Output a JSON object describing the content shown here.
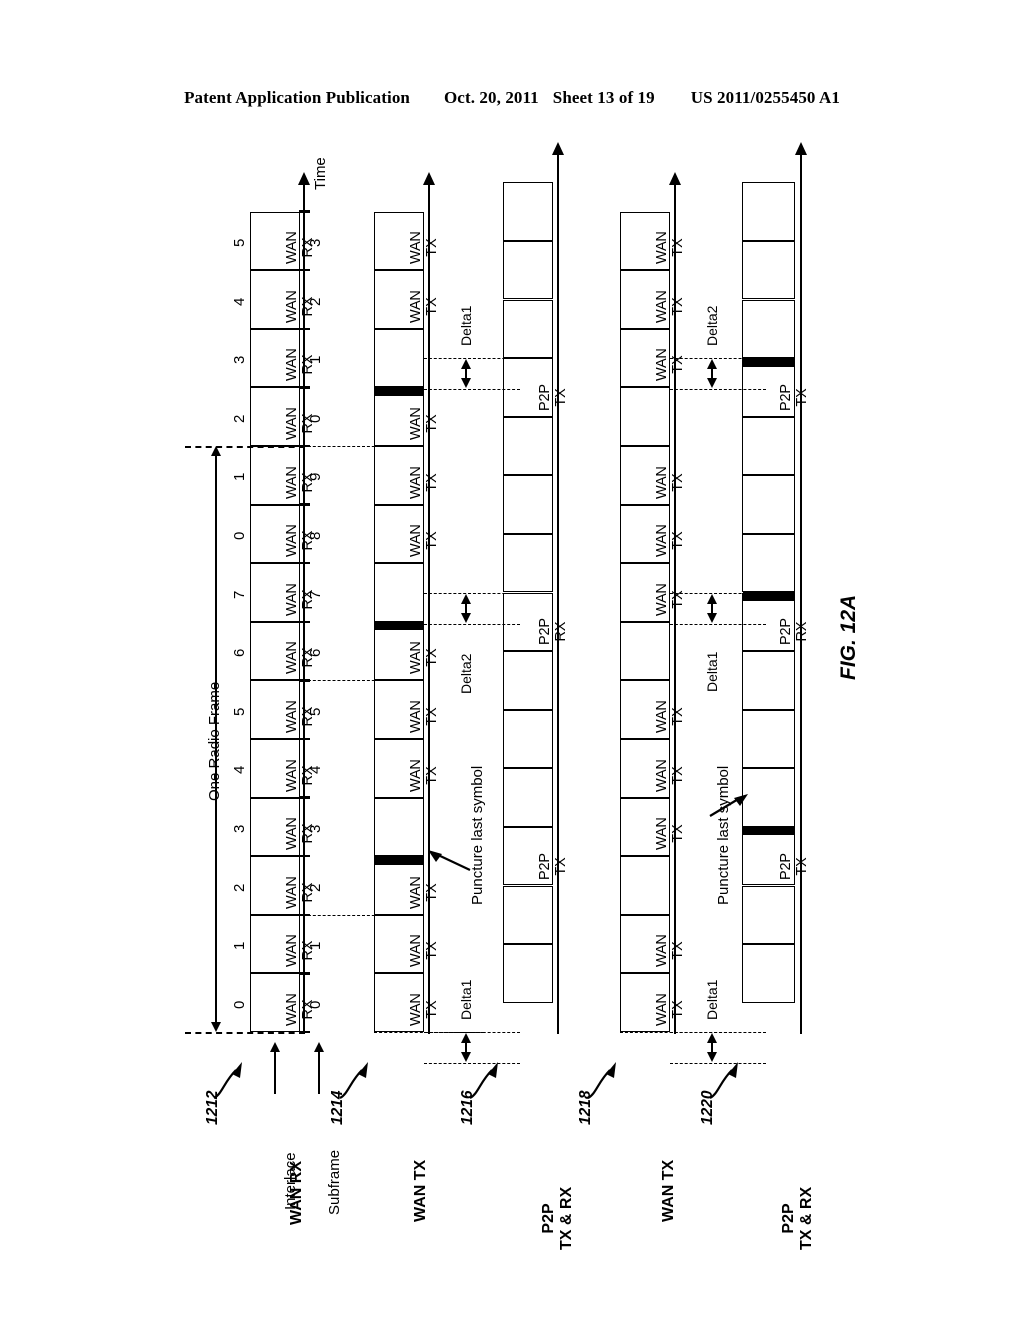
{
  "page_header": {
    "publication": "Patent Application Publication",
    "date": "Oct. 20, 2011",
    "sheet": "Sheet 13 of 19",
    "doc_number": "US 2011/0255450 A1"
  },
  "figure": {
    "label": "FIG. 12A",
    "time_axis_label": "Time",
    "frame_label": "One Radio Frame",
    "row_axis_labels": {
      "interlace": "Interlace",
      "subframe": "Subframe"
    },
    "annotations": {
      "puncture": "Puncture last symbol",
      "delta1": "Delta1",
      "delta2": "Delta2"
    },
    "tracks": [
      {
        "ref": "1212",
        "name": "WAN RX",
        "title_lines": [
          "WAN RX"
        ],
        "interlace_indexes": [
          "0",
          "1",
          "2",
          "3",
          "4",
          "5",
          "6",
          "7",
          "0",
          "1",
          "2",
          "3",
          "4",
          "5"
        ],
        "subframe_indexes": [
          "0",
          "1",
          "2",
          "3",
          "4",
          "5",
          "6",
          "7",
          "8",
          "9",
          "0",
          "1",
          "2",
          "3"
        ],
        "cells": [
          {
            "label": "WAN\nRX",
            "punctured": false
          },
          {
            "label": "WAN\nRX",
            "punctured": false
          },
          {
            "label": "WAN\nRX",
            "punctured": false
          },
          {
            "label": "WAN\nRX",
            "punctured": false
          },
          {
            "label": "WAN\nRX",
            "punctured": false
          },
          {
            "label": "WAN\nRX",
            "punctured": false
          },
          {
            "label": "WAN\nRX",
            "punctured": false
          },
          {
            "label": "WAN\nRX",
            "punctured": false
          },
          {
            "label": "WAN\nRX",
            "punctured": false
          },
          {
            "label": "WAN\nRX",
            "punctured": false
          },
          {
            "label": "WAN\nRX",
            "punctured": false
          },
          {
            "label": "WAN\nRX",
            "punctured": false
          },
          {
            "label": "WAN\nRX",
            "punctured": false
          },
          {
            "label": "WAN\nRX",
            "punctured": false
          }
        ]
      },
      {
        "ref": "1214",
        "name": "WAN TX",
        "title_lines": [
          "WAN TX"
        ],
        "cells": [
          {
            "label": "WAN\nTX",
            "punctured": false
          },
          {
            "label": "WAN\nTX",
            "punctured": false
          },
          {
            "label": "WAN\nTX",
            "punctured": true
          },
          {
            "label": "",
            "punctured": false
          },
          {
            "label": "WAN\nTX",
            "punctured": false
          },
          {
            "label": "WAN\nTX",
            "punctured": false
          },
          {
            "label": "WAN\nTX",
            "punctured": true
          },
          {
            "label": "",
            "punctured": false
          },
          {
            "label": "WAN\nTX",
            "punctured": false
          },
          {
            "label": "WAN\nTX",
            "punctured": false
          },
          {
            "label": "WAN\nTX",
            "punctured": true
          },
          {
            "label": "",
            "punctured": false
          },
          {
            "label": "WAN\nTX",
            "punctured": false
          },
          {
            "label": "WAN\nTX",
            "punctured": false
          }
        ]
      },
      {
        "ref": "1216",
        "name": "P2P TX & RX",
        "title_lines": [
          "P2P",
          "TX & RX"
        ],
        "cells": [
          {
            "label": "",
            "punctured": false
          },
          {
            "label": "",
            "punctured": false
          },
          {
            "label": "P2P\nTX",
            "punctured": false
          },
          {
            "label": "",
            "punctured": false
          },
          {
            "label": "",
            "punctured": false
          },
          {
            "label": "",
            "punctured": false
          },
          {
            "label": "P2P\nRX",
            "punctured": false
          },
          {
            "label": "",
            "punctured": false
          },
          {
            "label": "",
            "punctured": false
          },
          {
            "label": "",
            "punctured": false
          },
          {
            "label": "P2P\nTX",
            "punctured": false
          },
          {
            "label": "",
            "punctured": false
          },
          {
            "label": "",
            "punctured": false
          },
          {
            "label": "",
            "punctured": false
          }
        ]
      },
      {
        "ref": "1218",
        "name": "WAN TX",
        "title_lines": [
          "WAN TX"
        ],
        "cells": [
          {
            "label": "WAN\nTX",
            "punctured": false
          },
          {
            "label": "WAN\nTX",
            "punctured": false
          },
          {
            "label": "",
            "punctured": false
          },
          {
            "label": "WAN\nTX",
            "punctured": false
          },
          {
            "label": "WAN\nTX",
            "punctured": false
          },
          {
            "label": "WAN\nTX",
            "punctured": false
          },
          {
            "label": "",
            "punctured": false
          },
          {
            "label": "WAN\nTX",
            "punctured": false
          },
          {
            "label": "WAN\nTX",
            "punctured": false
          },
          {
            "label": "WAN\nTX",
            "punctured": false
          },
          {
            "label": "",
            "punctured": false
          },
          {
            "label": "WAN\nTX",
            "punctured": false
          },
          {
            "label": "WAN\nTX",
            "punctured": false
          },
          {
            "label": "WAN\nTX",
            "punctured": false
          }
        ]
      },
      {
        "ref": "1220",
        "name": "P2P TX & RX",
        "title_lines": [
          "P2P",
          "TX & RX"
        ],
        "cells": [
          {
            "label": "",
            "punctured": false
          },
          {
            "label": "",
            "punctured": false
          },
          {
            "label": "P2P\nTX",
            "punctured": true
          },
          {
            "label": "",
            "punctured": false
          },
          {
            "label": "",
            "punctured": false
          },
          {
            "label": "",
            "punctured": false
          },
          {
            "label": "P2P\nRX",
            "punctured": true
          },
          {
            "label": "",
            "punctured": false
          },
          {
            "label": "",
            "punctured": false
          },
          {
            "label": "",
            "punctured": false
          },
          {
            "label": "P2P\nTX",
            "punctured": true
          },
          {
            "label": "",
            "punctured": false
          },
          {
            "label": "",
            "punctured": false
          },
          {
            "label": "",
            "punctured": false
          }
        ]
      }
    ]
  }
}
